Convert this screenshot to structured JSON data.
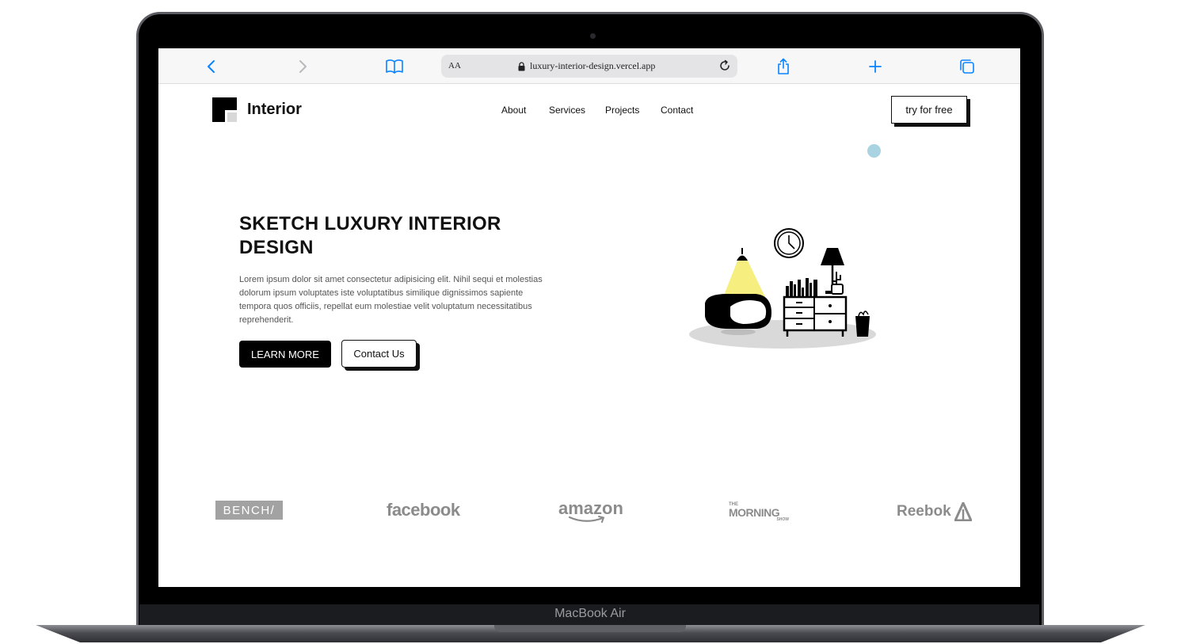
{
  "device": {
    "label": "MacBook Air"
  },
  "browser": {
    "text_size_label": "AA",
    "url": "luxury-interior-design.vercel.app"
  },
  "site": {
    "logo_text": "Interior",
    "nav": [
      "About",
      "Services",
      "Projects",
      "Contact"
    ],
    "cta": "try for free"
  },
  "hero": {
    "title": "SKETCH LUXURY INTERIOR DESIGN",
    "body": "Lorem ipsum dolor sit amet consectetur adipisicing elit. Nihil sequi et molestias dolorum ipsum voluptates iste voluptatibus similique dignissimos sapiente tempora quos officiis, repellat eum molestiae velit voluptatum necessitatibus reprehenderit.",
    "primary_button": "LEARN MORE",
    "secondary_button": "Contact Us"
  },
  "brands": {
    "bench": "BENCH/",
    "facebook": "facebook",
    "amazon": "amazon",
    "morning_show_small": "THE",
    "morning_show": "MORNING",
    "morning_show_sub": "SHOW",
    "reebok": "Reebok"
  },
  "colors": {
    "accent_blue": "#0a84ff",
    "dot": "#a9d3e0",
    "lamp_light": "#f5ec6a",
    "brand_gray": "#8b8b8b"
  }
}
